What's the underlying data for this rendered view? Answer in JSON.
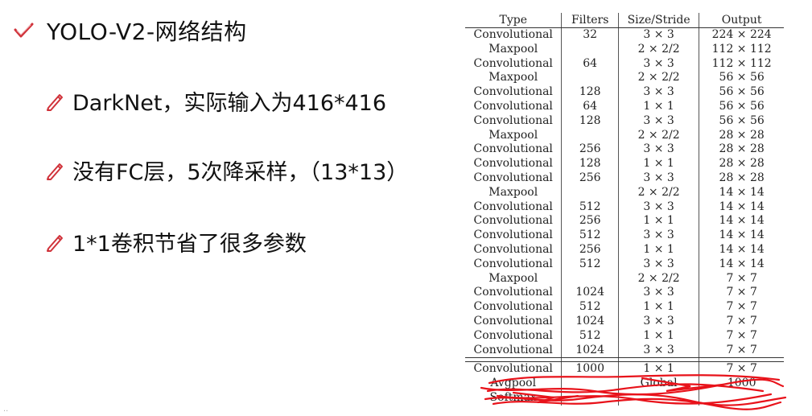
{
  "slide": {
    "title": "YOLO-V2-网络结构",
    "bullets": [
      "DarkNet，实际输入为416*416",
      "没有FC层，5次降采样，（13*13）",
      "1*1卷积节省了很多参数"
    ],
    "accent_color": "#d0323a"
  },
  "table": {
    "headers": [
      "Type",
      "Filters",
      "Size/Stride",
      "Output"
    ],
    "rows": [
      [
        "Convolutional",
        "32",
        "3 × 3",
        "224 × 224"
      ],
      [
        "Maxpool",
        "",
        "2 × 2/2",
        "112 × 112"
      ],
      [
        "Convolutional",
        "64",
        "3 × 3",
        "112 × 112"
      ],
      [
        "Maxpool",
        "",
        "2 × 2/2",
        "56 × 56"
      ],
      [
        "Convolutional",
        "128",
        "3 × 3",
        "56 × 56"
      ],
      [
        "Convolutional",
        "64",
        "1 × 1",
        "56 × 56"
      ],
      [
        "Convolutional",
        "128",
        "3 × 3",
        "56 × 56"
      ],
      [
        "Maxpool",
        "",
        "2 × 2/2",
        "28 × 28"
      ],
      [
        "Convolutional",
        "256",
        "3 × 3",
        "28 × 28"
      ],
      [
        "Convolutional",
        "128",
        "1 × 1",
        "28 × 28"
      ],
      [
        "Convolutional",
        "256",
        "3 × 3",
        "28 × 28"
      ],
      [
        "Maxpool",
        "",
        "2 × 2/2",
        "14 × 14"
      ],
      [
        "Convolutional",
        "512",
        "3 × 3",
        "14 × 14"
      ],
      [
        "Convolutional",
        "256",
        "1 × 1",
        "14 × 14"
      ],
      [
        "Convolutional",
        "512",
        "3 × 3",
        "14 × 14"
      ],
      [
        "Convolutional",
        "256",
        "1 × 1",
        "14 × 14"
      ],
      [
        "Convolutional",
        "512",
        "3 × 3",
        "14 × 14"
      ],
      [
        "Maxpool",
        "",
        "2 × 2/2",
        "7 × 7"
      ],
      [
        "Convolutional",
        "1024",
        "3 × 3",
        "7 × 7"
      ],
      [
        "Convolutional",
        "512",
        "1 × 1",
        "7 × 7"
      ],
      [
        "Convolutional",
        "1024",
        "3 × 3",
        "7 × 7"
      ],
      [
        "Convolutional",
        "512",
        "1 × 1",
        "7 × 7"
      ],
      [
        "Convolutional",
        "1024",
        "3 × 3",
        "7 × 7"
      ]
    ],
    "crossed_rows": [
      [
        "Convolutional",
        "1000",
        "1 × 1",
        "7 × 7"
      ],
      [
        "Avgpool",
        "",
        "Global",
        "1000"
      ],
      [
        "Softmax",
        "",
        "",
        ""
      ]
    ],
    "scribble_color": "#e8121a"
  }
}
